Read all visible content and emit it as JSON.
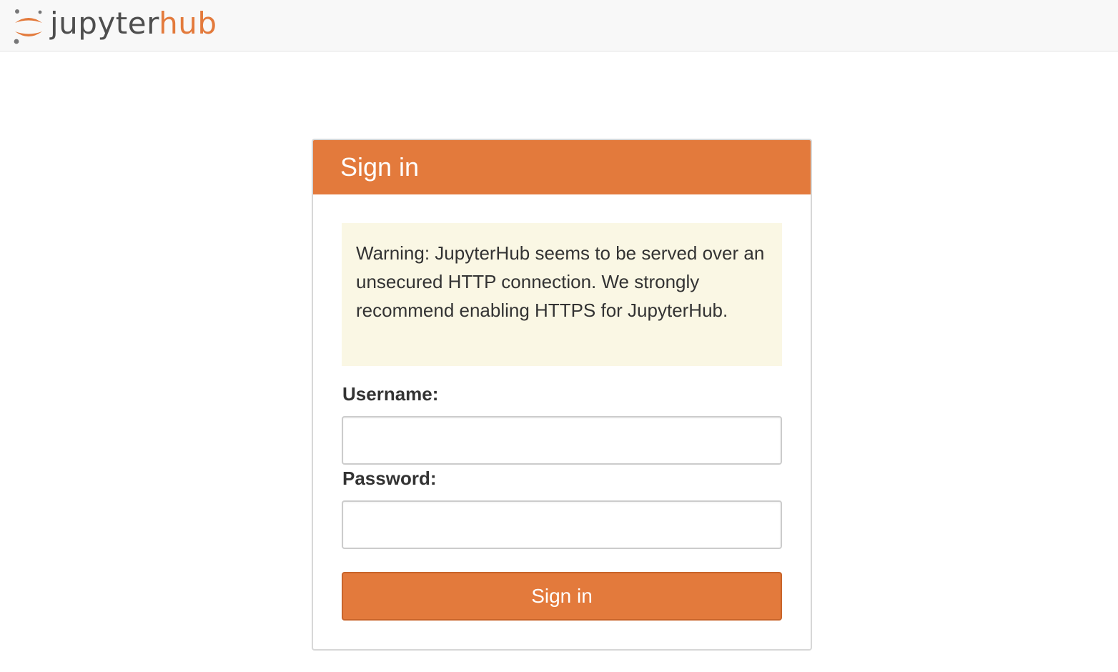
{
  "brand": {
    "name_part1": "jupyter",
    "name_part2": "hub",
    "accent_color": "#e37a3c",
    "logo_icon": "jupyter-logo-icon"
  },
  "login": {
    "title": "Sign in",
    "warning": "Warning: JupyterHub seems to be served over an unsecured HTTP connection. We strongly recommend enabling HTTPS for JupyterHub.",
    "username_label": "Username:",
    "username_value": "",
    "password_label": "Password:",
    "password_value": "",
    "submit_label": "Sign in"
  }
}
